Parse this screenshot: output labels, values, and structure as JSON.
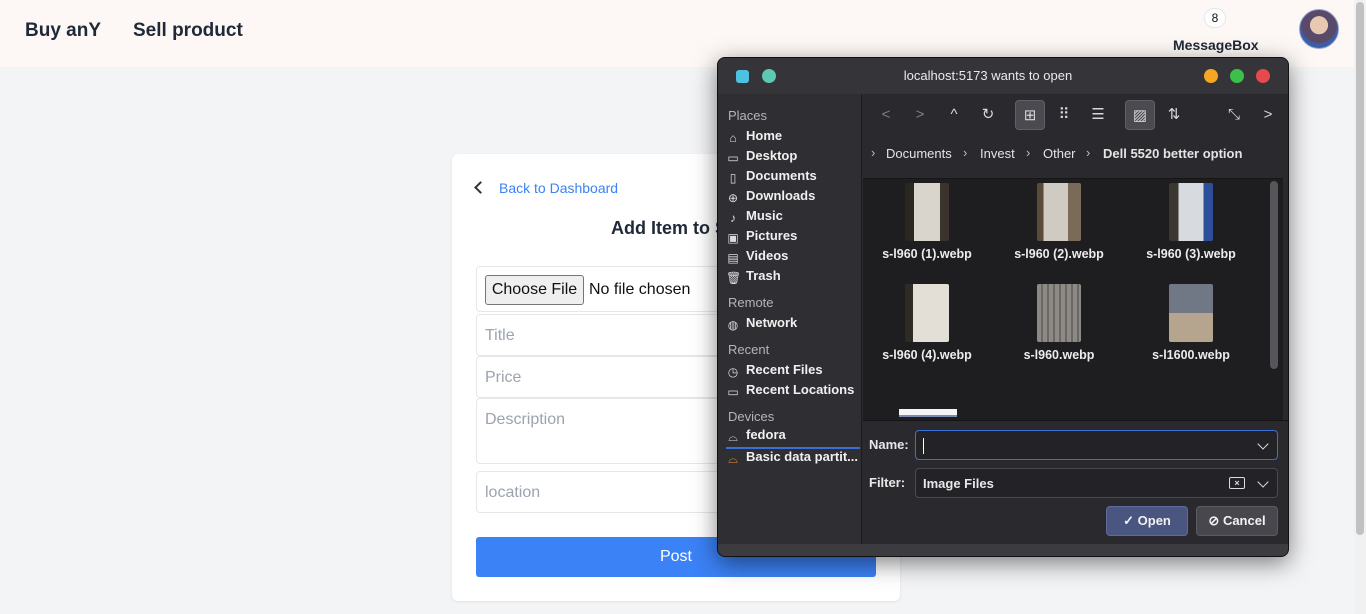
{
  "header": {
    "brand": "Buy anY",
    "nav_sell": "Sell product",
    "message_count": "8",
    "message_label": "MessageBox"
  },
  "card": {
    "back_link": "Back to Dashboard",
    "title": "Add Item to S",
    "choose_file": "Choose File",
    "no_file": "No file chosen",
    "title_placeholder": "Title",
    "price_placeholder": "Price",
    "description_placeholder": "Description",
    "location_placeholder": "location",
    "post_label": "Post"
  },
  "dialog": {
    "title": "localhost:5173 wants to open",
    "places_heading": "Places",
    "places": [
      {
        "label": "Home",
        "icon": "home-icon"
      },
      {
        "label": "Desktop",
        "icon": "desktop-icon"
      },
      {
        "label": "Documents",
        "icon": "document-icon"
      },
      {
        "label": "Downloads",
        "icon": "download-icon"
      },
      {
        "label": "Music",
        "icon": "music-icon"
      },
      {
        "label": "Pictures",
        "icon": "picture-icon"
      },
      {
        "label": "Videos",
        "icon": "video-icon"
      },
      {
        "label": "Trash",
        "icon": "trash-icon"
      }
    ],
    "remote_heading": "Remote",
    "remote": [
      {
        "label": "Network",
        "icon": "globe-icon"
      }
    ],
    "recent_heading": "Recent",
    "recent": [
      {
        "label": "Recent Files",
        "icon": "recent-files-icon"
      },
      {
        "label": "Recent Locations",
        "icon": "recent-locations-icon"
      }
    ],
    "devices_heading": "Devices",
    "devices": [
      {
        "label": "fedora",
        "icon": "drive-icon"
      },
      {
        "label": "Basic data partit...",
        "icon": "drive-warning-icon"
      }
    ],
    "breadcrumbs": [
      "Documents",
      "Invest",
      "Other",
      "Dell 5520 better option"
    ],
    "files": [
      {
        "name": "s-l960 (1).webp",
        "color": "#c9c4bc"
      },
      {
        "name": "s-l960 (2).webp",
        "color": "#b7b2aa"
      },
      {
        "name": "s-l960 (3).webp",
        "color": "#cfd3d8"
      },
      {
        "name": "s-l960 (4).webp",
        "color": "#d6d1c8"
      },
      {
        "name": "s-l960.webp",
        "color": "#8d8a86"
      },
      {
        "name": "s-l1600.webp",
        "color": "#6f7884"
      }
    ],
    "name_label": "Name:",
    "name_value": "",
    "filter_label": "Filter:",
    "filter_value": "Image Files",
    "open_label": "Open",
    "cancel_label": "Cancel",
    "colors": {
      "minimize": "#f5a623",
      "maximize": "#3cc04a",
      "close": "#e5484d",
      "accent": "#3b6fd8"
    }
  }
}
